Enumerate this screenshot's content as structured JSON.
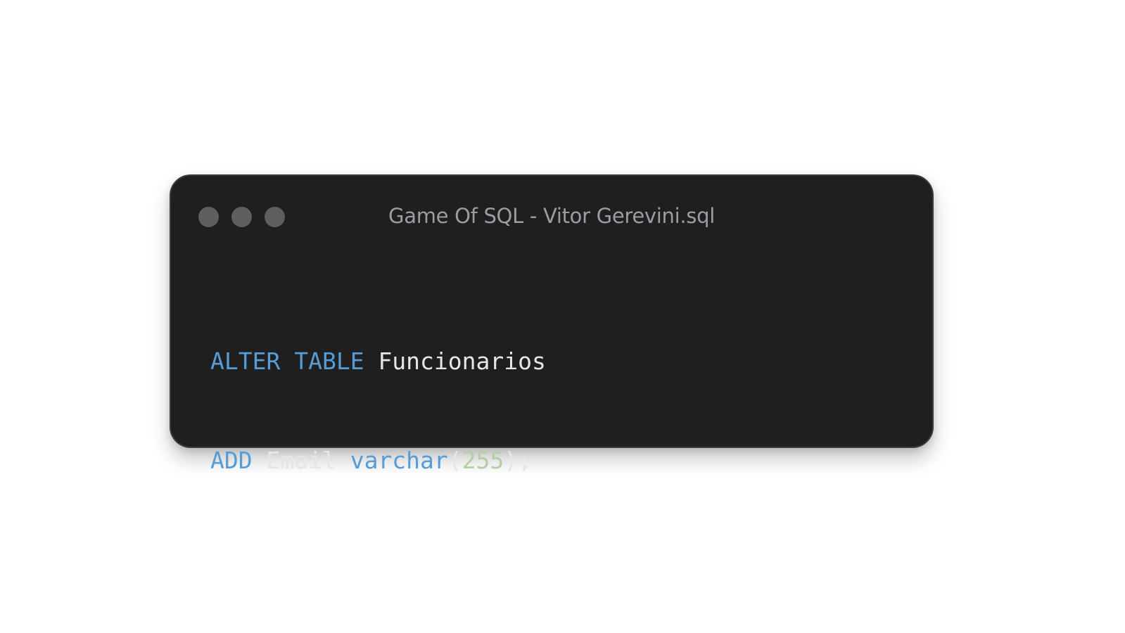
{
  "window": {
    "title": "Game Of SQL - Vitor Gerevini.sql"
  },
  "code": {
    "lines": [
      {
        "tokens": [
          {
            "text": "ALTER",
            "kind": "keyword"
          },
          {
            "text": " ",
            "kind": "space"
          },
          {
            "text": "TABLE",
            "kind": "keyword"
          },
          {
            "text": " ",
            "kind": "space"
          },
          {
            "text": "Funcionarios",
            "kind": "identifier"
          }
        ]
      },
      {
        "tokens": [
          {
            "text": "ADD",
            "kind": "keyword"
          },
          {
            "text": " ",
            "kind": "space"
          },
          {
            "text": "Email",
            "kind": "identifier"
          },
          {
            "text": " ",
            "kind": "space"
          },
          {
            "text": "varchar",
            "kind": "keyword"
          },
          {
            "text": "(",
            "kind": "punctuation"
          },
          {
            "text": "255",
            "kind": "number"
          },
          {
            "text": ");",
            "kind": "punctuation"
          }
        ]
      }
    ]
  },
  "colors": {
    "window_background": "#1f1f1f",
    "keyword": "#569cd6",
    "number": "#b5cea8",
    "identifier": "#e6e6e6",
    "title": "#9b9da4",
    "window_control": "#5f5f5f"
  },
  "icons": {
    "window_controls": [
      "window-control-dot-icon",
      "window-control-dot-icon",
      "window-control-dot-icon"
    ]
  }
}
